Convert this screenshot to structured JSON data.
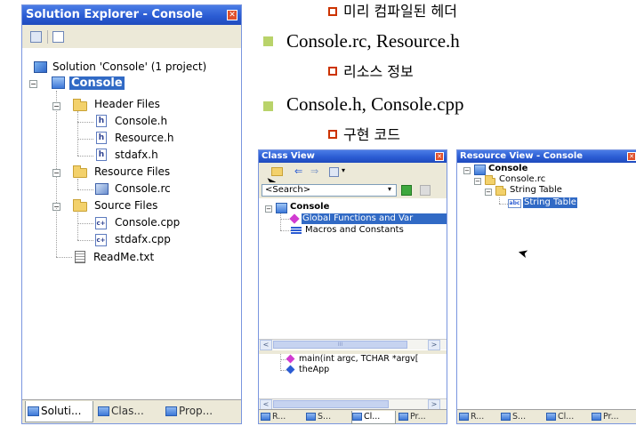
{
  "solution_explorer": {
    "title": "Solution Explorer - Console",
    "close": "✕",
    "solution_label": "Solution 'Console' (1 project)",
    "project": "Console",
    "folders": [
      {
        "label": "Header Files",
        "files": [
          "Console.h",
          "Resource.h",
          "stdafx.h"
        ]
      },
      {
        "label": "Resource Files",
        "files": [
          "Console.rc"
        ]
      },
      {
        "label": "Source Files",
        "files": [
          "Console.cpp",
          "stdafx.cpp"
        ]
      }
    ],
    "readme": "ReadMe.txt",
    "tabs": [
      "Soluti...",
      "Clas...",
      "Prop..."
    ]
  },
  "slide": {
    "items": [
      {
        "text": "미리 컴파일된 헤더"
      },
      {
        "text": "Console.rc, Resource.h"
      },
      {
        "text": "리소스 정보"
      },
      {
        "text": "Console.h, Console.cpp"
      },
      {
        "text": "구현 코드"
      }
    ],
    "colors": {
      "bullet": "#b9d36a",
      "sub_bullet": "#cc3300"
    }
  },
  "class_view": {
    "title": "Class View",
    "close": "✕",
    "search": "<Search>",
    "root": "Console",
    "items": [
      "Global Functions and Var",
      "Macros and Constants"
    ],
    "members": [
      "main(int argc, TCHAR *argv[",
      "theApp"
    ],
    "scroll_thumb": "III",
    "tabs": [
      "R...",
      "S...",
      "Cl...",
      "Pr..."
    ]
  },
  "resource_view": {
    "title": "Resource View - Console",
    "close": "✕",
    "root": "Console",
    "rc": "Console.rc",
    "table": "String Table",
    "item": "String Table",
    "tabs": [
      "R...",
      "S...",
      "Cl...",
      "Pr..."
    ]
  },
  "colors": {
    "title_bar": "#2b5cd3",
    "selection": "#316ac5",
    "close_button": "#e0502c"
  }
}
